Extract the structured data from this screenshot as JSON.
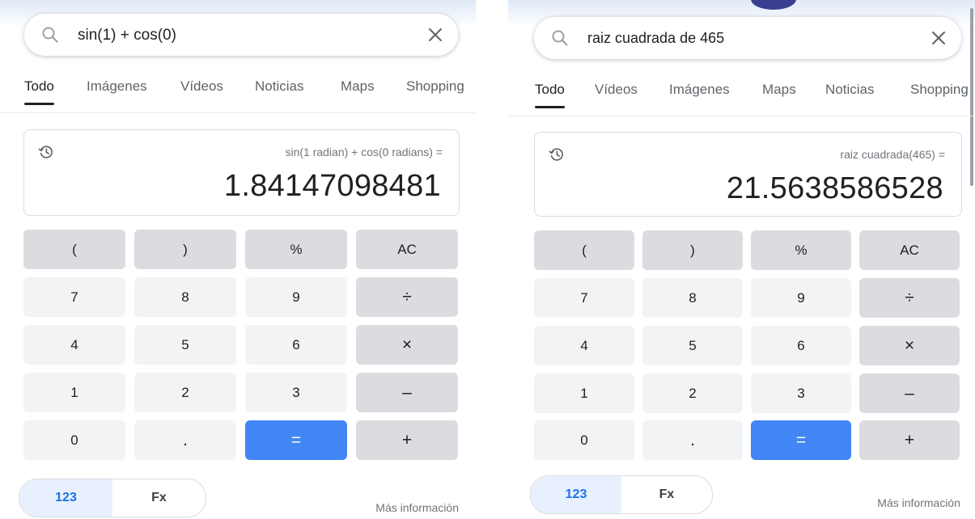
{
  "colors": {
    "accent_blue": "#4285f4",
    "mode_active_text": "#1a73e8",
    "mode_active_bg": "#e8f0fe",
    "key_gray": "#dadce0",
    "key_light": "#f1f3f4",
    "text_primary": "#202124",
    "text_secondary": "#70757a"
  },
  "icons": {
    "search": "search-icon",
    "clear": "close-icon",
    "history": "history-icon"
  },
  "left": {
    "search": {
      "query": "sin(1) + cos(0)"
    },
    "tabs": [
      {
        "label": "Todo",
        "active": true
      },
      {
        "label": "Imágenes",
        "active": false
      },
      {
        "label": "Vídeos",
        "active": false
      },
      {
        "label": "Noticias",
        "active": false
      },
      {
        "label": "Maps",
        "active": false
      },
      {
        "label": "Shopping",
        "active": false
      }
    ],
    "calculator": {
      "expression": "sin(1 radian) + cos(0 radians) =",
      "result": "1.84147098481"
    },
    "footer": {
      "more_info": "Más información"
    }
  },
  "right": {
    "search": {
      "query": "raiz cuadrada de 465"
    },
    "tabs": [
      {
        "label": "Todo",
        "active": true
      },
      {
        "label": "Vídeos",
        "active": false
      },
      {
        "label": "Imágenes",
        "active": false
      },
      {
        "label": "Maps",
        "active": false
      },
      {
        "label": "Noticias",
        "active": false
      },
      {
        "label": "Shopping",
        "active": false
      }
    ],
    "calculator": {
      "expression": "raiz cuadrada(465) =",
      "result": "21.5638586528"
    },
    "footer": {
      "more_info": "Más información"
    }
  },
  "keypad": {
    "open_paren": "(",
    "close_paren": ")",
    "percent": "%",
    "clear_all": "AC",
    "seven": "7",
    "eight": "8",
    "nine": "9",
    "divide": "÷",
    "four": "4",
    "five": "5",
    "six": "6",
    "multiply": "×",
    "one": "1",
    "two": "2",
    "three": "3",
    "minus": "–",
    "zero": "0",
    "decimal": ".",
    "equals": "=",
    "plus": "+"
  },
  "mode": {
    "basic": "123",
    "functions": "Fx"
  }
}
